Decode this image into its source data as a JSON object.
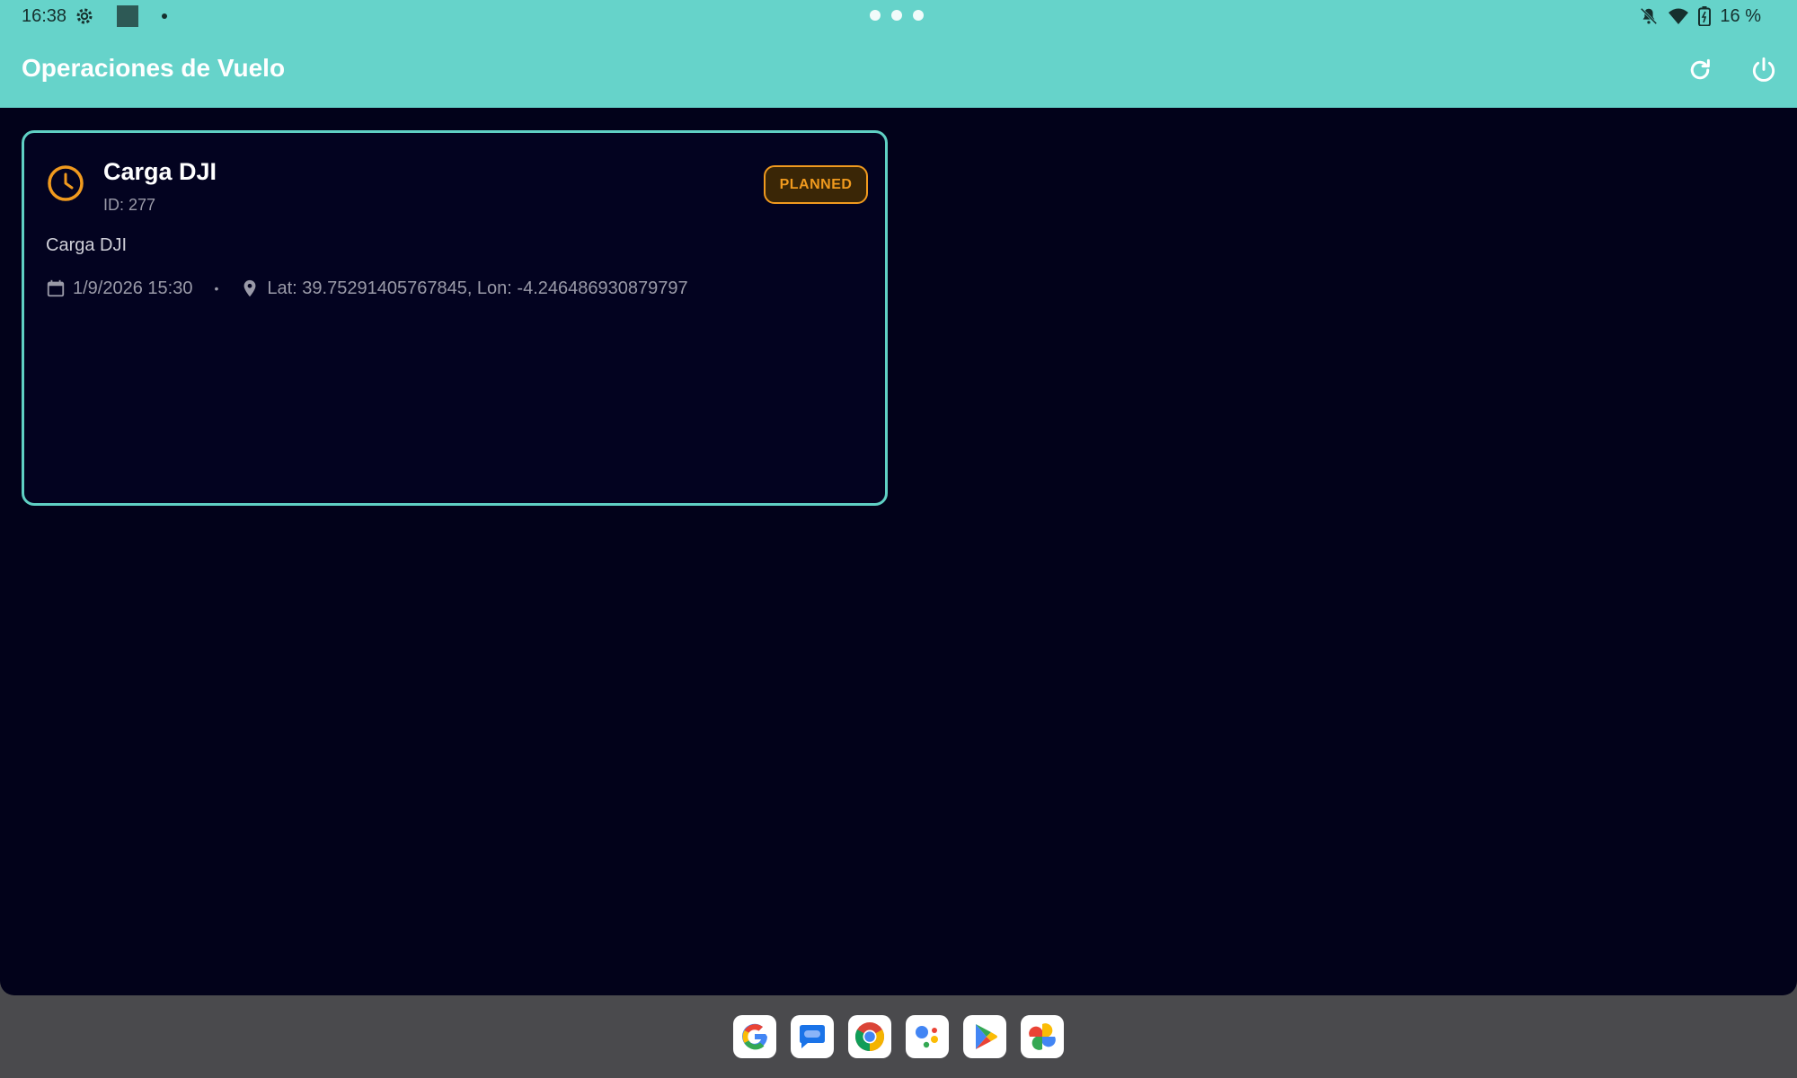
{
  "status_bar": {
    "time": "16:38",
    "battery": "16 %"
  },
  "app_bar": {
    "title": "Operaciones de Vuelo"
  },
  "operations": [
    {
      "title": "Carga DJI",
      "id": "ID: 277",
      "status": "PLANNED",
      "description": "Carga DJI",
      "datetime": "1/9/2026 15:30",
      "separator": "•",
      "location": "Lat: 39.75291405767845, Lon: -4.246486930879797"
    }
  ],
  "colors": {
    "accent": "#66d3ca",
    "background": "#02021a",
    "status_planned": "#f09a1e"
  },
  "dock": {
    "apps": [
      "google-icon",
      "messages-icon",
      "chrome-icon",
      "assistant-icon",
      "play-store-icon",
      "photos-icon"
    ]
  }
}
